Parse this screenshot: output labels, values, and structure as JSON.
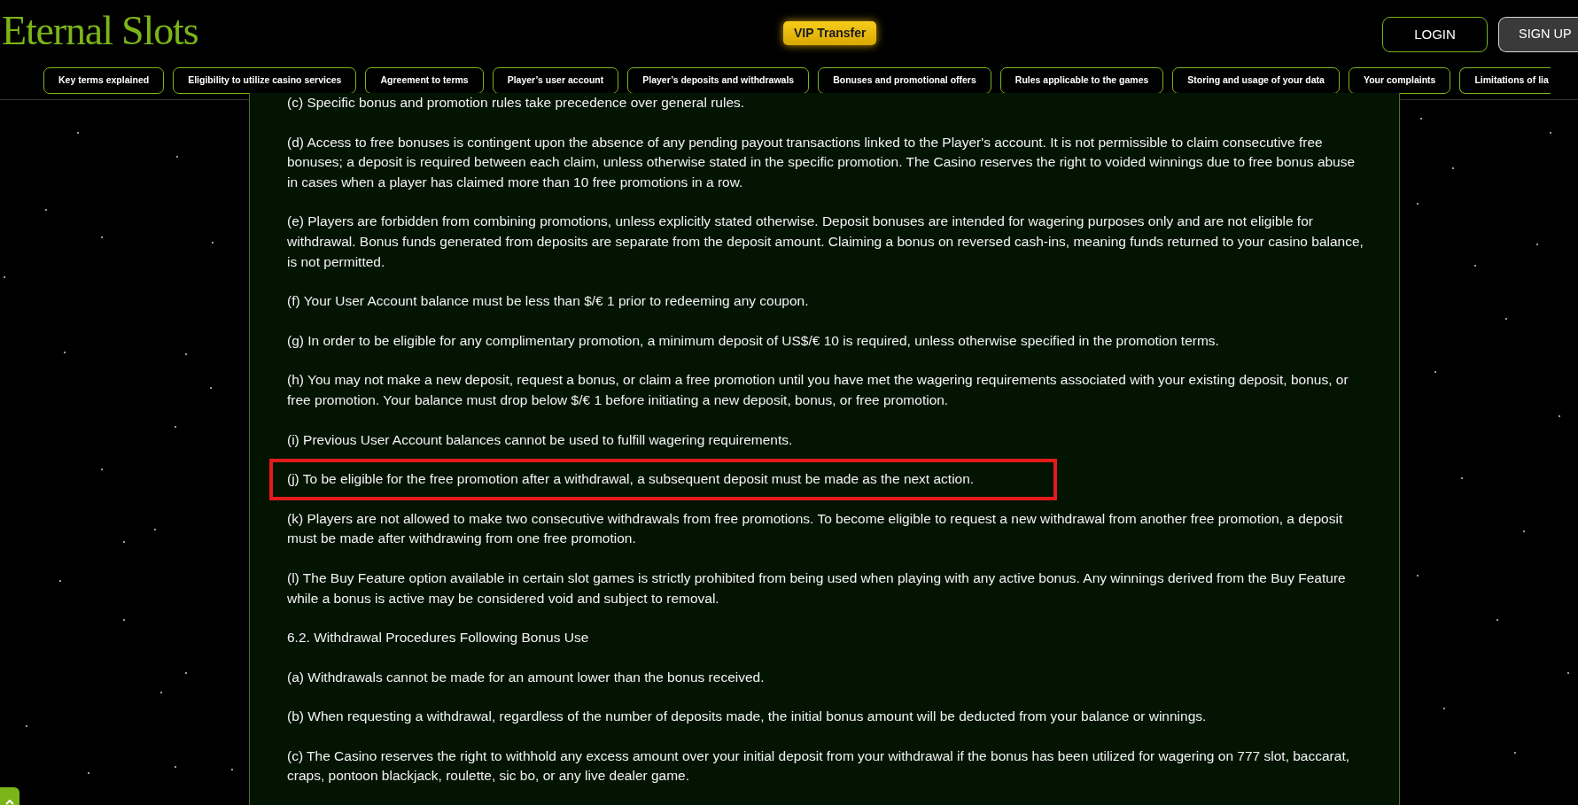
{
  "header": {
    "logo": "Eternal Slots",
    "vip_badge": "VIP Transfer",
    "buttons": [
      {
        "label": "LOGIN",
        "kind": "outline"
      },
      {
        "label": "SIGN UP",
        "kind": "filled"
      }
    ]
  },
  "nav_tabs": [
    {
      "label": "Key terms explained"
    },
    {
      "label": "Eligibility to utilize casino services"
    },
    {
      "label": "Agreement to terms"
    },
    {
      "label": "Player’s user account"
    },
    {
      "label": "Player’s deposits and withdrawals"
    },
    {
      "label": "Bonuses and promotional offers"
    },
    {
      "label": "Rules applicable to the games"
    },
    {
      "label": "Storing and usage of your data"
    },
    {
      "label": "Your complaints"
    },
    {
      "label": "Limitations of lia"
    }
  ],
  "paragraphs": [
    {
      "text": "(c) Specific bonus and promotion rules take precedence over general rules.",
      "highlighted": false
    },
    {
      "text": "(d) Access to free bonuses is contingent upon the absence of any pending payout transactions linked to the Player's account. It is not permissible to claim consecutive free bonuses; a deposit is required between each claim, unless otherwise stated in the specific promotion. The Casino reserves the right to voided winnings due to free bonus abuse in cases when a player has claimed more than 10 free promotions in a row.",
      "highlighted": false
    },
    {
      "text": "(e) Players are forbidden from combining promotions, unless explicitly stated otherwise. Deposit bonuses are intended for wagering purposes only and are not eligible for withdrawal. Bonus funds generated from deposits are separate from the deposit amount. Claiming a bonus on reversed cash-ins, meaning funds returned to your casino balance, is not permitted.",
      "highlighted": false
    },
    {
      "text": "(f) Your User Account balance must be less than $/€ 1 prior to redeeming any coupon.",
      "highlighted": false
    },
    {
      "text": "(g) In order to be eligible for any complimentary promotion, a minimum deposit of US$/€ 10 is required, unless otherwise specified in the promotion terms.",
      "highlighted": false
    },
    {
      "text": "(h) You may not make a new deposit, request a bonus, or claim a free promotion until you have met the wagering requirements associated with your existing deposit, bonus, or free promotion. Your balance must drop below $/€ 1 before initiating a new deposit, bonus, or free promotion.",
      "highlighted": false
    },
    {
      "text": "(i) Previous User Account balances cannot be used to fulfill wagering requirements.",
      "highlighted": false
    },
    {
      "text": "(j) To be eligible for the free promotion after a withdrawal, a subsequent deposit must be made as the next action.",
      "highlighted": true
    },
    {
      "text": "(k) Players are not allowed to make two consecutive withdrawals from free promotions. To become eligible to request a new withdrawal from another free promotion, a deposit must be made after withdrawing from one free promotion.",
      "highlighted": false
    },
    {
      "text": "(l) The Buy Feature option available in certain slot games is strictly prohibited from being used when playing with any active bonus. Any winnings derived from the Buy Feature while a bonus is active may be considered void and subject to removal.",
      "highlighted": false
    },
    {
      "text": "6.2. Withdrawal Procedures Following Bonus Use",
      "highlighted": false
    },
    {
      "text": "(a) Withdrawals cannot be made for an amount lower than the bonus received.",
      "highlighted": false
    },
    {
      "text": "(b) When requesting a withdrawal, regardless of the number of deposits made, the initial bonus amount will be deducted from your balance or winnings.",
      "highlighted": false
    },
    {
      "text": "(c) The Casino reserves the right to withhold any excess amount over your initial deposit from your withdrawal if the bonus has been utilized for wagering on 777 slot, baccarat, craps, pontoon blackjack, roulette, sic bo, or any live dealer game.",
      "highlighted": false
    }
  ]
}
